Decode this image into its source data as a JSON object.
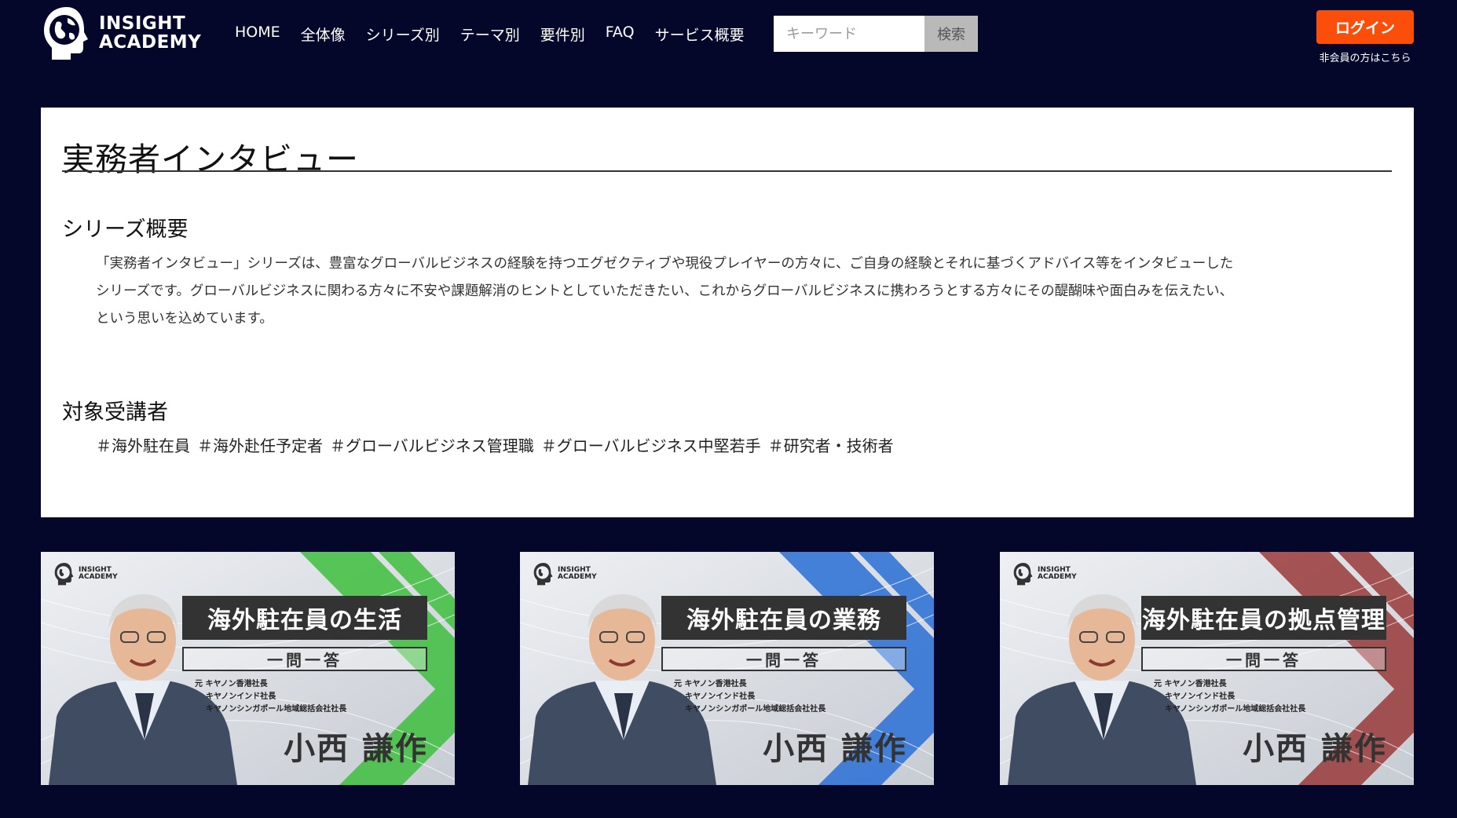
{
  "header": {
    "logo_line1": "INSIGHT",
    "logo_line2": "ACADEMY",
    "nav": [
      "HOME",
      "全体像",
      "シリーズ別",
      "テーマ別",
      "要件別",
      "FAQ",
      "サービス概要"
    ],
    "search_placeholder": "キーワード",
    "search_button": "検索",
    "login_label": "ログイン",
    "nonmember_link": "非会員の方はこちら"
  },
  "main": {
    "title": "実務者インタビュー",
    "overview_heading": "シリーズ概要",
    "overview_lines": [
      "「実務者インタビュー」シリーズは、豊富なグローバルビジネスの経験を持つエグゼクティブや現役プレイヤーの方々に、ご自身の経験とそれに基づくアドバイス等をインタビューした",
      "シリーズです。グローバルビジネスに関わる方々に不安や課題解消のヒントとしていただきたい、これからグローバルビジネスに携わろうとする方々にその醍醐味や面白みを伝えたい、",
      "という思いを込めています。"
    ],
    "target_heading": "対象受講者",
    "tags": [
      "＃海外駐在員",
      "＃海外赴任予定者",
      "＃グローバルビジネス管理職",
      "＃グローバルビジネス中堅若手",
      "＃研究者・技術者"
    ]
  },
  "videos": [
    {
      "title": "海外駐在員の生活",
      "subtitle": "一問一答",
      "roles": [
        "元 キヤノン香港社長",
        "キヤノンインド社長",
        "キヤノンシンガポール地域総括会社社長"
      ],
      "name": "小西 謙作",
      "accent": "#3fbf3f",
      "logo_line1": "INSIGHT",
      "logo_line2": "ACADEMY"
    },
    {
      "title": "海外駐在員の業務",
      "subtitle": "一問一答",
      "roles": [
        "元 キヤノン香港社長",
        "キヤノンインド社長",
        "キヤノンシンガポール地域総括会社社長"
      ],
      "name": "小西 謙作",
      "accent": "#2a6fd6",
      "logo_line1": "INSIGHT",
      "logo_line2": "ACADEMY"
    },
    {
      "title": "海外駐在員の拠点管理",
      "subtitle": "一問一答",
      "roles": [
        "元 キヤノン香港社長",
        "キヤノンインド社長",
        "キヤノンシンガポール地域総括会社社長"
      ],
      "name": "小西 謙作",
      "accent": "#9a3a3a",
      "logo_line1": "INSIGHT",
      "logo_line2": "ACADEMY"
    }
  ],
  "colors": {
    "background": "#05072a",
    "login_button": "#fb4e0b",
    "search_button": "#b9b9b9"
  }
}
